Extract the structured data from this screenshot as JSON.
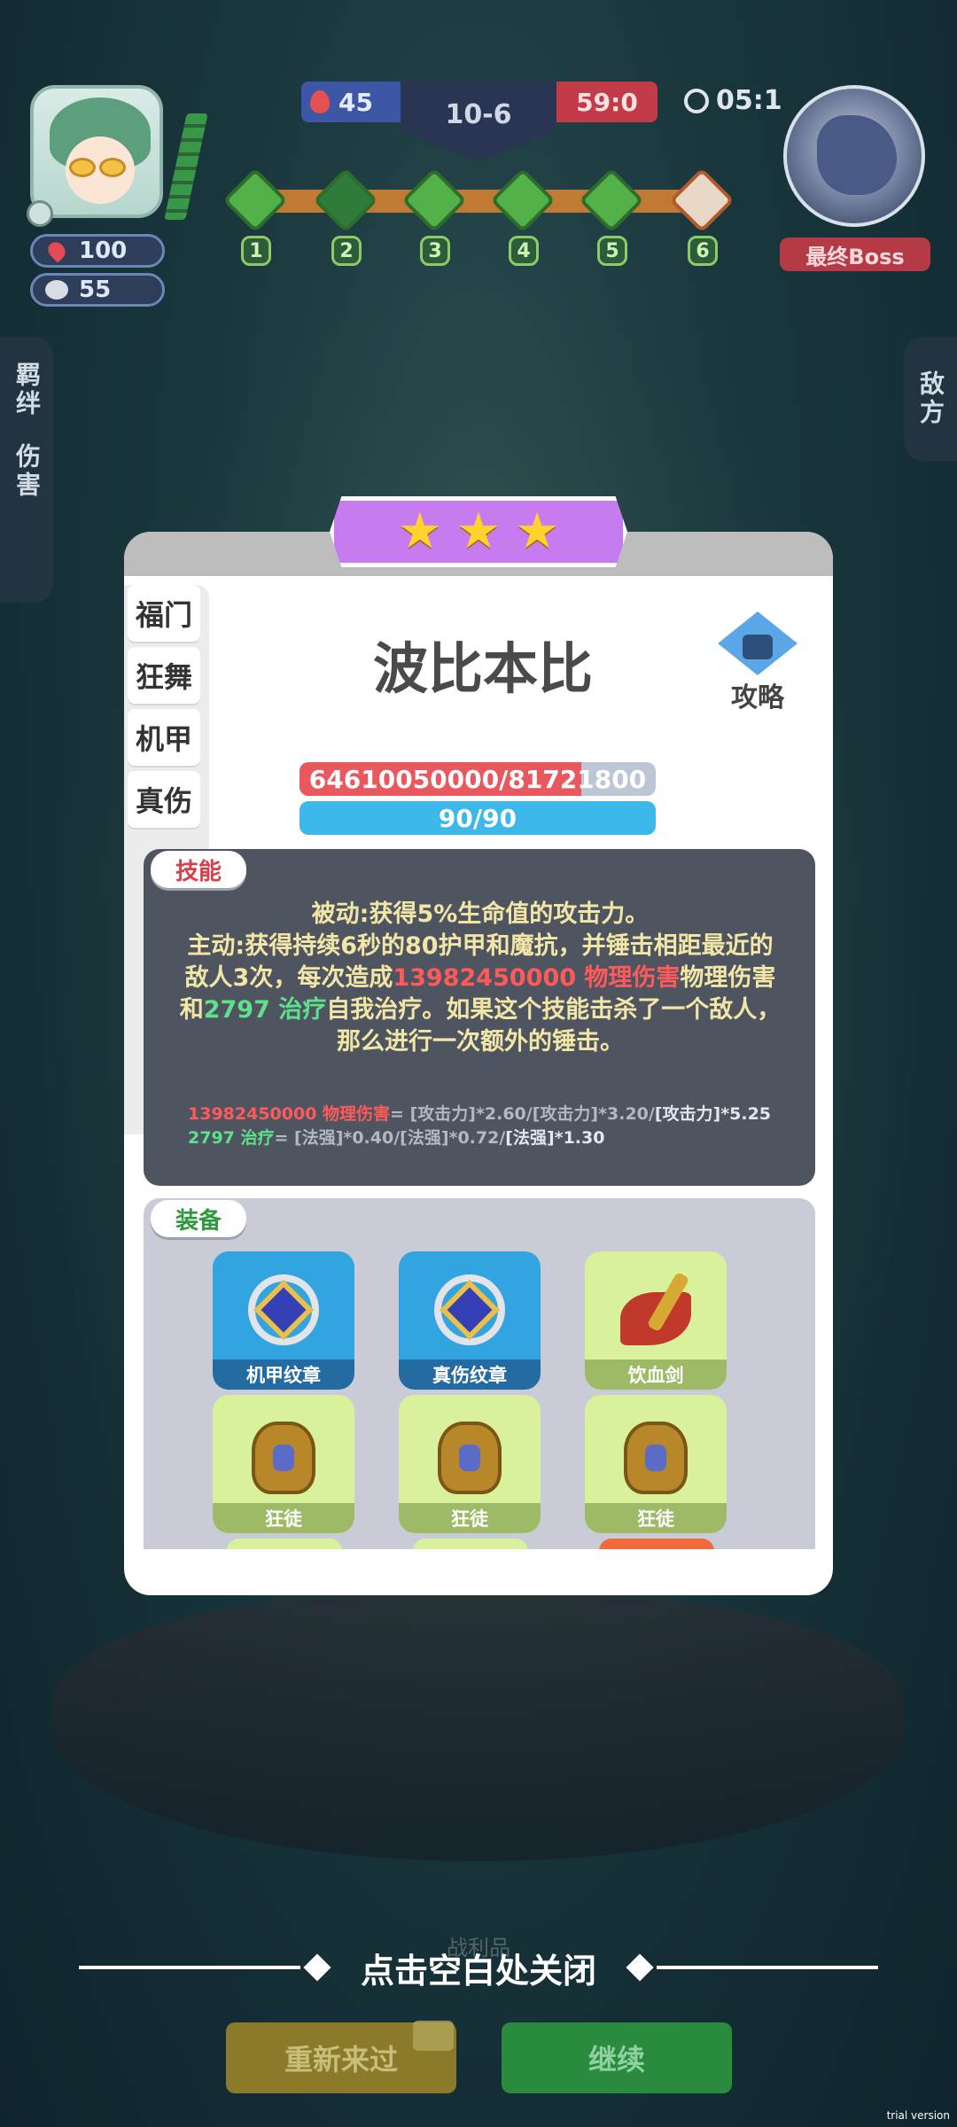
{
  "hud": {
    "player": {
      "hp": "100",
      "coins": "55"
    },
    "score_left": "45",
    "stage": "10-6",
    "score_right": "59:0",
    "timer": "05:1",
    "path_nodes": [
      "1",
      "2",
      "3",
      "4",
      "5",
      "6"
    ],
    "boss_label": "最终Boss"
  },
  "side_tabs": {
    "left": [
      "羁绊",
      "伤害"
    ],
    "right": "敌方"
  },
  "modal": {
    "stars": 3,
    "hero_name": "波比本比",
    "guide_label": "攻略",
    "tabs": [
      "福门",
      "狂舞",
      "机甲",
      "真伤"
    ],
    "hp_text": "64610050000/81721800",
    "hp_fraction": 0.79,
    "mana_text": "90/90",
    "skill": {
      "label": "技能",
      "passive": "被动:获得5%生命值的攻击力。",
      "active_1": "主动:获得持续6秒的80护甲和魔抗，并锤击相距最近的敌人3次，每次造成",
      "active_dmg": "13982450000 物理伤害",
      "active_2": "物理伤害",
      "active_3": "和",
      "heal": "2797 治疗",
      "active_4": "自我治疗。如果这个技能击杀了一个敌人，那么进行一次额外的锤击。",
      "formula_1_val": "13982450000 物理伤害",
      "formula_1_ref": "= [攻击力]*2.60/[攻击力]*3.20/",
      "formula_1_end": "[攻击力]*5.25",
      "formula_2_val": "2797 治疗",
      "formula_2_ref": "= [法强]*0.40/[法强]*0.72/",
      "formula_2_end": "[法强]*1.30"
    },
    "equipment": {
      "label": "装备",
      "items": [
        "机甲纹章",
        "真伤纹章",
        "饮血剑",
        "狂徒",
        "狂徒",
        "狂徒"
      ]
    }
  },
  "bottom": {
    "behind_label": "战利品",
    "close_hint": "点击空白处关闭",
    "retry": "重新来过",
    "continue": "继续",
    "trial": "trial version"
  },
  "colors": {
    "modal_bg": "#ffffff",
    "skill_panel": "#4f5560",
    "equip_panel": "#c9ccd6",
    "star_badge": "#c77bf0"
  }
}
